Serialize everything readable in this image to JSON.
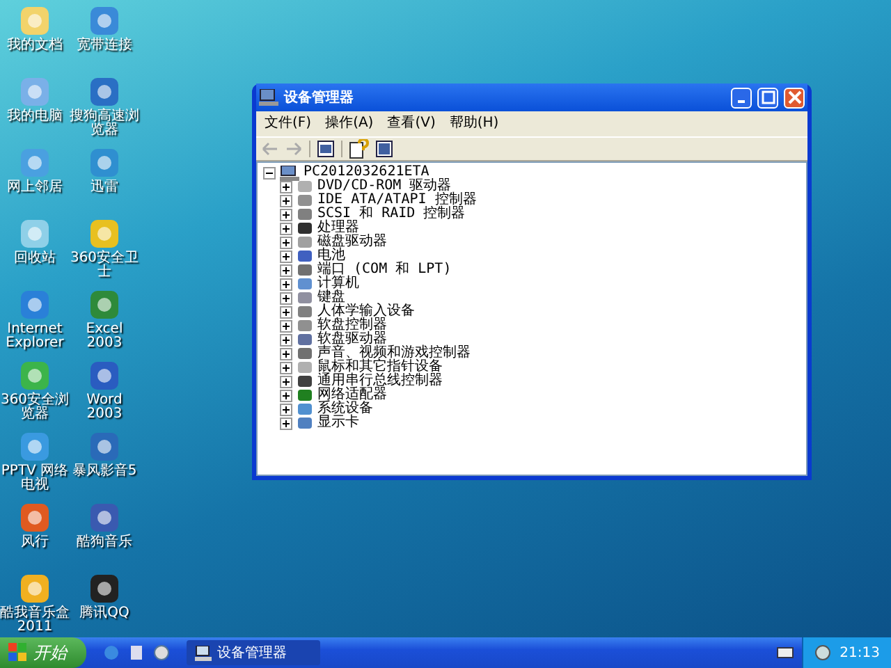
{
  "desktop_icons": [
    {
      "label": "我的文档"
    },
    {
      "label": "宽带连接"
    },
    {
      "label": "我的电脑"
    },
    {
      "label": "搜狗高速浏览器"
    },
    {
      "label": "网上邻居"
    },
    {
      "label": "迅雷"
    },
    {
      "label": "回收站"
    },
    {
      "label": "360安全卫士"
    },
    {
      "label": "Internet Explorer"
    },
    {
      "label": "Excel 2003"
    },
    {
      "label": "360安全浏览器"
    },
    {
      "label": "Word 2003"
    },
    {
      "label": "PPTV 网络电视"
    },
    {
      "label": "暴风影音5"
    },
    {
      "label": "风行"
    },
    {
      "label": "酷狗音乐"
    },
    {
      "label": "酷我音乐盒 2011"
    },
    {
      "label": "腾讯QQ"
    }
  ],
  "window": {
    "title": "设备管理器",
    "menu": [
      "文件(F)",
      "操作(A)",
      "查看(V)",
      "帮助(H)"
    ],
    "tree": {
      "label": "PC2012032621ETA",
      "expanded": true,
      "children": [
        {
          "label": "DVD/CD-ROM 驱动器",
          "expanded": false
        },
        {
          "label": "IDE ATA/ATAPI 控制器",
          "expanded": false
        },
        {
          "label": "SCSI 和 RAID 控制器",
          "expanded": false
        },
        {
          "label": "处理器",
          "expanded": false
        },
        {
          "label": "磁盘驱动器",
          "expanded": false
        },
        {
          "label": "电池",
          "expanded": false
        },
        {
          "label": "端口 (COM 和 LPT)",
          "expanded": false
        },
        {
          "label": "计算机",
          "expanded": false
        },
        {
          "label": "键盘",
          "expanded": false
        },
        {
          "label": "人体学输入设备",
          "expanded": false
        },
        {
          "label": "软盘控制器",
          "expanded": false
        },
        {
          "label": "软盘驱动器",
          "expanded": false
        },
        {
          "label": "声音、视频和游戏控制器",
          "expanded": false
        },
        {
          "label": "鼠标和其它指针设备",
          "expanded": false
        },
        {
          "label": "通用串行总线控制器",
          "expanded": false
        },
        {
          "label": "网络适配器",
          "expanded": false
        },
        {
          "label": "系统设备",
          "expanded": false
        },
        {
          "label": "显示卡",
          "expanded": false
        }
      ]
    }
  },
  "taskbar": {
    "start": "开始",
    "tasks": [
      {
        "label": "设备管理器",
        "selected": true
      }
    ],
    "clock": "21:13"
  }
}
